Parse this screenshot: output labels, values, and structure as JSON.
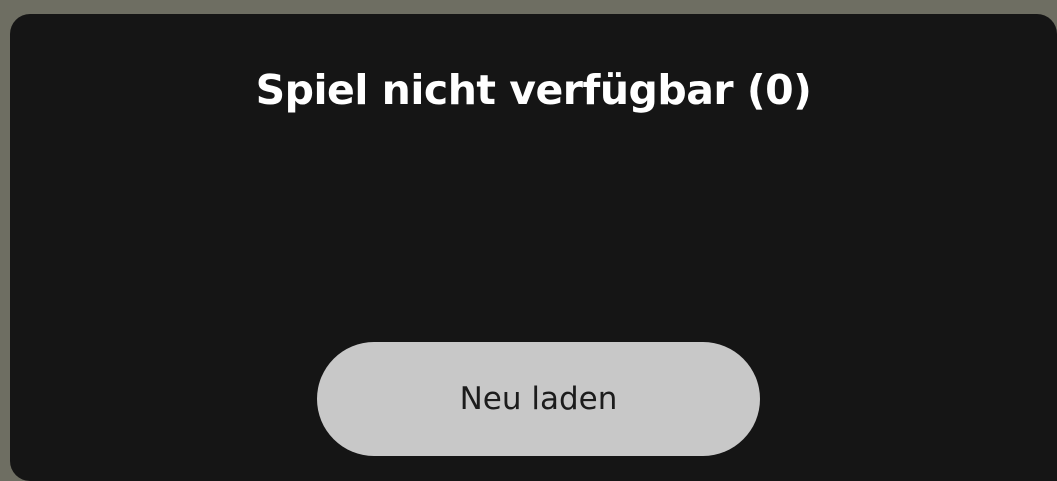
{
  "dialog": {
    "title": "Spiel nicht verfügbar (0)",
    "reload_label": "Neu laden"
  },
  "colors": {
    "backdrop": "#6e6e62",
    "dialog_background": "#151515",
    "title_text": "#ffffff",
    "button_background": "#c8c8c8",
    "button_text": "#1c1c1c"
  }
}
